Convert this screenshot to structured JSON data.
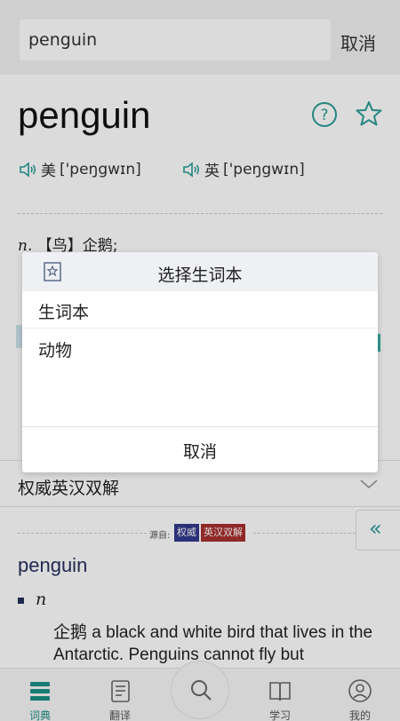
{
  "search": {
    "value": "penguin",
    "cancel_label": "取消"
  },
  "word": {
    "headword": "penguin"
  },
  "pronunciations": [
    {
      "region": "美",
      "ipa": "['peŋgwɪn]"
    },
    {
      "region": "英",
      "ipa": "['peŋgwɪn]"
    }
  ],
  "definition": {
    "pos": "n.",
    "text": "【鸟】企鹅;"
  },
  "section": {
    "title": "权威英汉双解"
  },
  "source": {
    "label": "源自:",
    "tag1": "权威",
    "tag2": "英汉双解"
  },
  "side_button": {
    "glyph": "«"
  },
  "entry": {
    "word": "penguin",
    "pos": "n",
    "definition": "企鹅 a black and white bird that lives in the Antarctic. Penguins cannot fly but"
  },
  "dialog": {
    "title": "选择生词本",
    "items": [
      "生词本",
      "动物"
    ],
    "cancel_label": "取消"
  },
  "bottom_nav": {
    "items": [
      {
        "label": "词典",
        "icon": "dictionary-icon",
        "active": true
      },
      {
        "label": "翻译",
        "icon": "translate-icon",
        "active": false
      },
      {
        "label": "学习",
        "icon": "book-icon",
        "active": false
      },
      {
        "label": "我的",
        "icon": "profile-icon",
        "active": false
      }
    ],
    "center_icon": "search-icon"
  },
  "colors": {
    "accent": "#2a9c96",
    "entry_word": "#25305c",
    "tag1_bg": "#333a8c",
    "tag2_bg": "#a8302e"
  }
}
